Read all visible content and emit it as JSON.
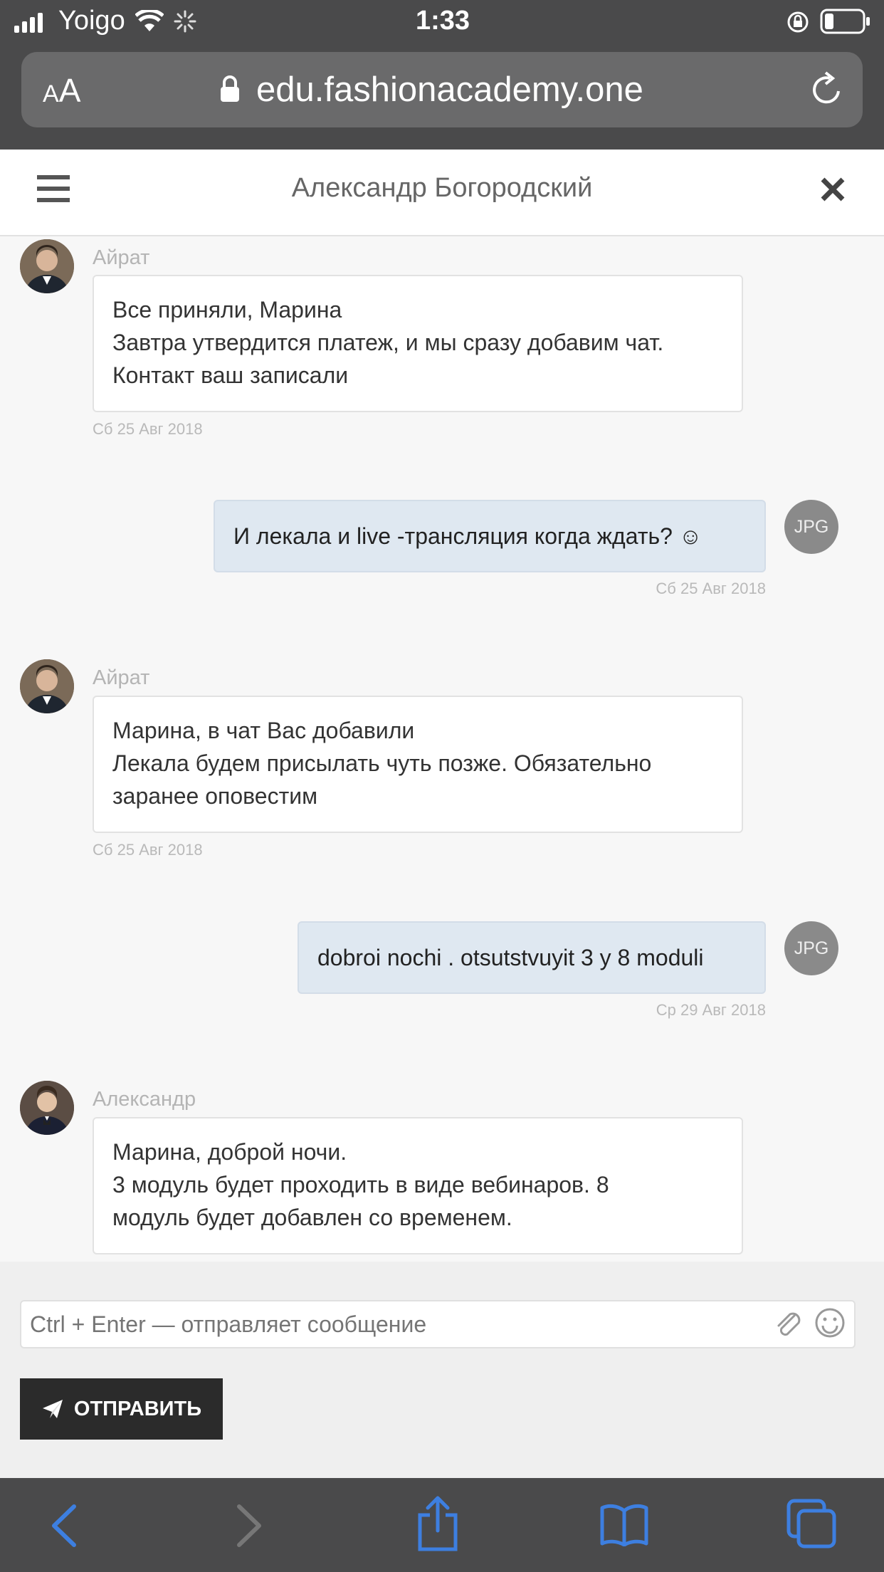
{
  "status_bar": {
    "carrier": "Yoigo",
    "time": "1:33"
  },
  "browser": {
    "text_size_label": "AA",
    "url": "edu.fashionacademy.one"
  },
  "chat": {
    "title": "Александр Богородский",
    "messages": [
      {
        "sender": "Айрат",
        "lines": [
          "Все приняли, Марина",
          "Завтра утвердится платеж, и мы сразу добавим чат.",
          "Контакт ваш записали"
        ],
        "timestamp": "Сб 25 Авг 2018"
      },
      {
        "avatar_label": "JPG",
        "lines": [
          "И лекала и live -трансляция когда ждать? ☺"
        ],
        "timestamp": "Сб 25 Авг 2018"
      },
      {
        "sender": "Айрат",
        "lines": [
          "Марина, в чат Вас добавили",
          "Лекала будем присылать чуть позже. Обязательно",
          "заранее оповестим"
        ],
        "timestamp": "Сб 25 Авг 2018"
      },
      {
        "avatar_label": "JPG",
        "lines": [
          "dobroi nochi . otsutstvuyit 3 y 8 moduli"
        ],
        "timestamp": "Ср 29 Авг 2018"
      },
      {
        "sender": "Александр",
        "lines": [
          "Марина, доброй ночи.",
          "3 модуль будет проходить в виде вебинаров. 8",
          "модуль будет добавлен со временем."
        ]
      }
    ]
  },
  "composer": {
    "placeholder": "Ctrl + Enter — отправляет сообщение",
    "send_label": "ОТПРАВИТЬ"
  },
  "colors": {
    "browser_chrome": "#4a4a4b",
    "toolbar_icon": "#3d7fe0",
    "outgoing_bubble": "#dfe8f1",
    "send_button": "#2b2b2b"
  }
}
